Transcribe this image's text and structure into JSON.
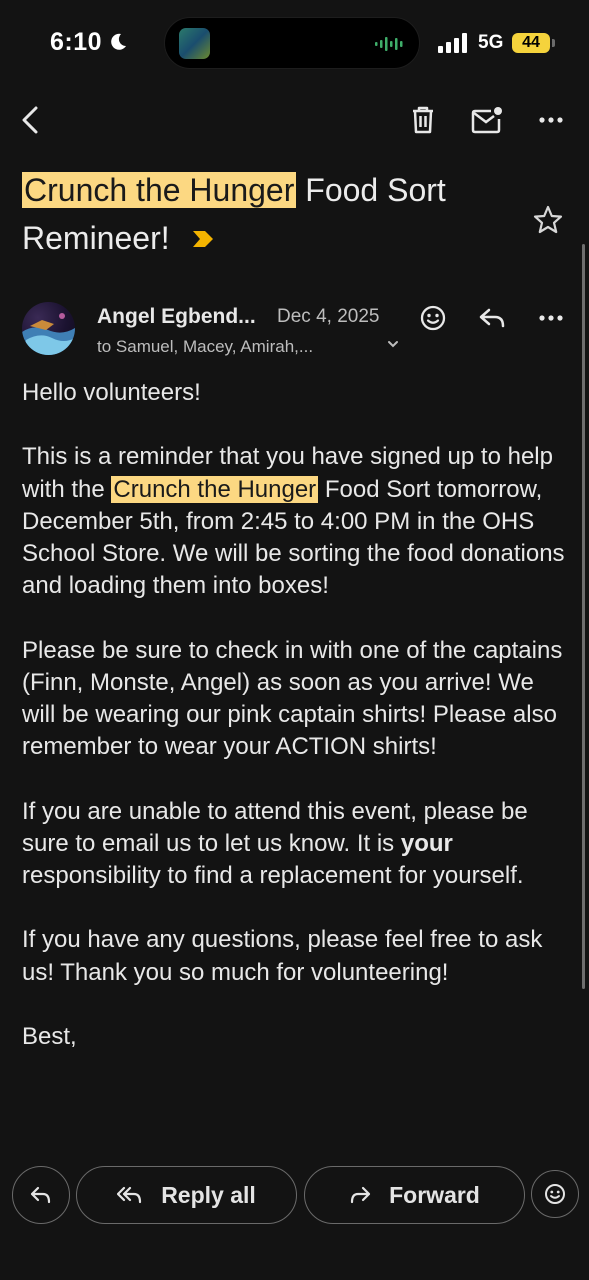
{
  "status": {
    "time": "6:10",
    "network": "5G",
    "battery": "44"
  },
  "icons": {
    "back": "back-arrow-icon",
    "delete": "trash-icon",
    "unread": "mark-unread-icon",
    "more": "more-horizontal-icon",
    "star": "star-icon",
    "importance": "importance-marker-icon",
    "emoji": "emoji-icon",
    "reply": "reply-icon",
    "reply_all": "reply-all-icon",
    "forward": "forward-icon"
  },
  "colors": {
    "highlight": "#fcd882",
    "importance": "#f4b400",
    "background": "#131313"
  },
  "email": {
    "subject_highlight": "Crunch the Hunger",
    "subject_rest_1": " Food Sort",
    "subject_rest_2": "Remineer!",
    "sender": "Angel Egbend...",
    "date": "Dec 4, 2025",
    "recipients": "to Samuel, Macey, Amirah,...",
    "greeting": "Hello volunteers!",
    "p1_a": "This is a reminder that you have signed up to help with the ",
    "p1_highlight": "Crunch the Hunger",
    "p1_b": " Food Sort tomorrow, December 5th, from 2:45 to 4:00 PM in the OHS School Store. We will be sorting the food donations and loading them into boxes!",
    "p2": "Please be sure to check in with one of the captains (Finn, Monste, Angel) as soon as you arrive! We will be wearing our pink captain shirts! Please also remember to wear your ACTION shirts!",
    "p3_a": " If you are unable to attend this event, please be sure to email us to let us know. It is ",
    "p3_bold": "your",
    "p3_b": " responsibility to find a replacement for yourself.",
    "p4": "If you have any questions, please feel free to ask us! Thank you so much for volunteering!",
    "signoff": "Best,"
  },
  "actions": {
    "reply_all": "Reply all",
    "forward": "Forward"
  }
}
